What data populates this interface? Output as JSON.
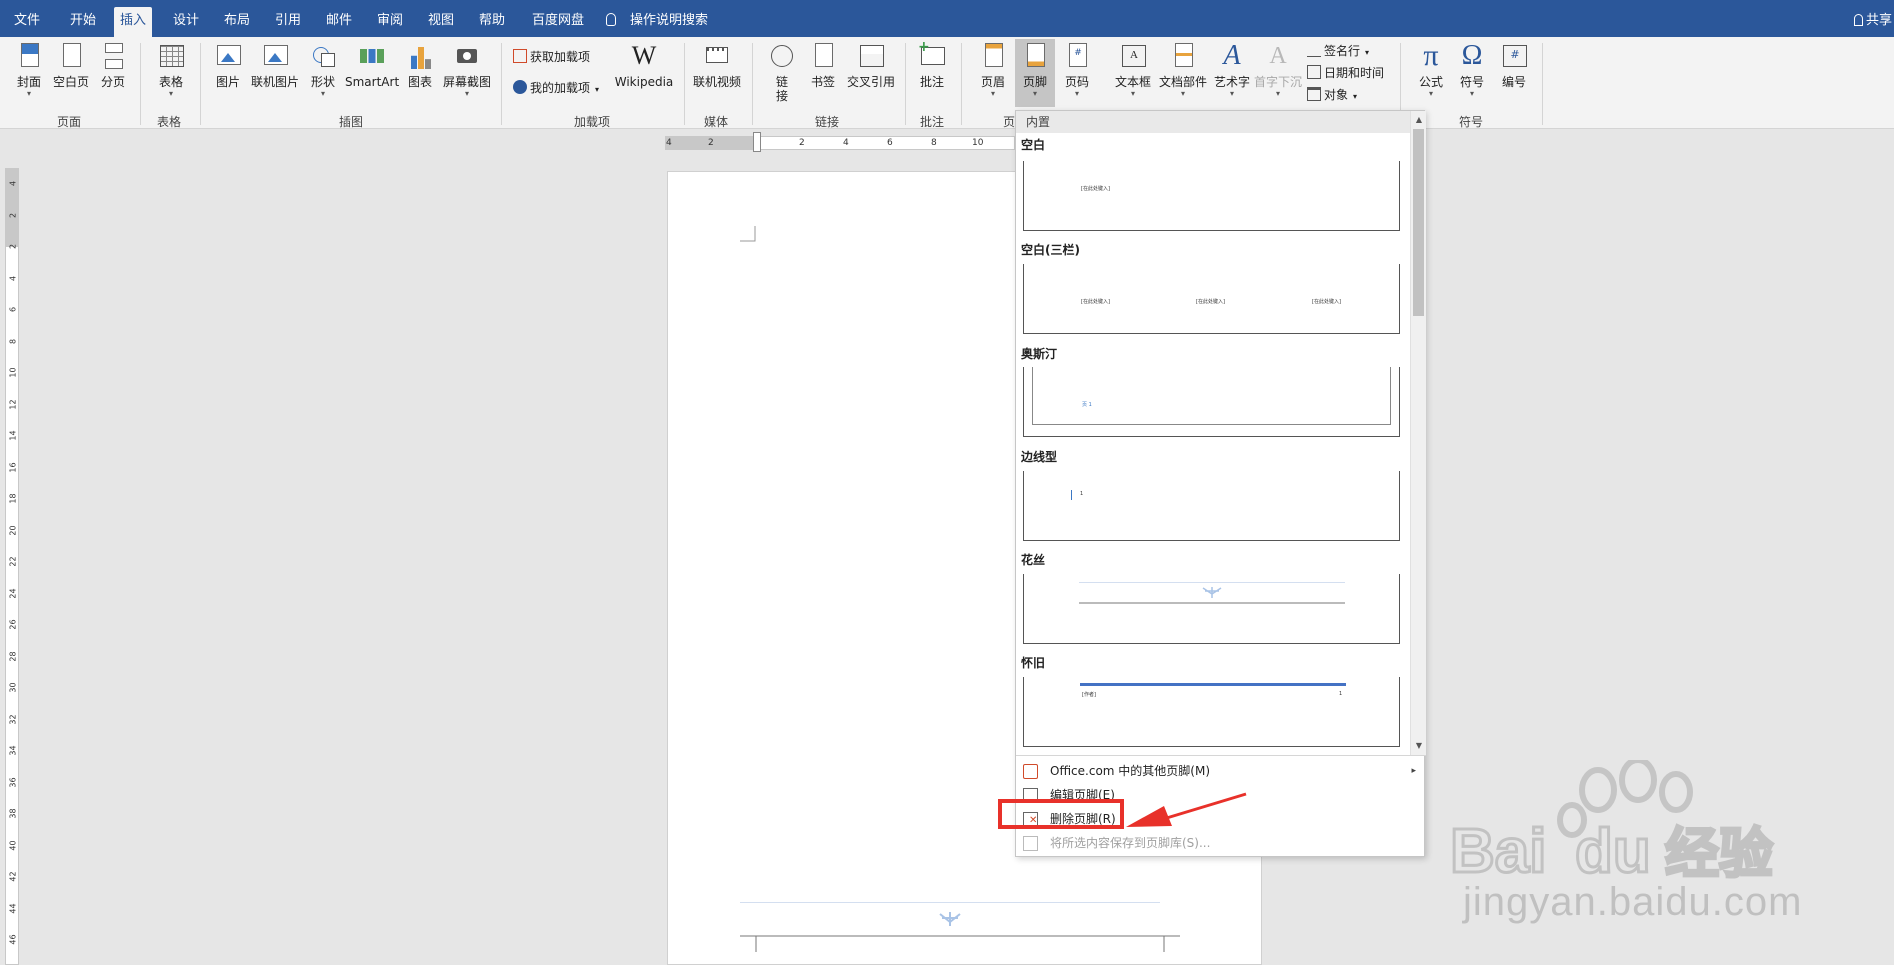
{
  "menubar": {
    "tabs": [
      "文件",
      "开始",
      "插入",
      "设计",
      "布局",
      "引用",
      "邮件",
      "审阅",
      "视图",
      "帮助",
      "百度网盘"
    ],
    "active_tab": "插入",
    "tell_me": "操作说明搜索",
    "share": "共享"
  },
  "ribbon": {
    "pages_group": {
      "label": "页面",
      "cover": "封面",
      "blank_page": "空白页",
      "page_break": "分页"
    },
    "tables_group": {
      "label": "表格",
      "table": "表格"
    },
    "illustrations_group": {
      "label": "插图",
      "pictures": "图片",
      "online_pictures": "联机图片",
      "shapes": "形状",
      "smartart": "SmartArt",
      "chart": "图表",
      "screenshot": "屏幕截图"
    },
    "addins_group": {
      "label": "加载项",
      "get_addins": "获取加载项",
      "my_addins": "我的加载项",
      "wikipedia": "Wikipedia"
    },
    "media_group": {
      "label": "媒体",
      "online_video": "联机视频"
    },
    "links_group": {
      "label": "链接",
      "link": "链接",
      "bookmark": "书签",
      "cross_reference": "交叉引用"
    },
    "comments_group": {
      "label": "批注",
      "comment": "批注"
    },
    "header_footer_group": {
      "label": "页",
      "header": "页眉",
      "footer": "页脚",
      "page_number": "页码"
    },
    "text_group": {
      "textbox": "文本框",
      "quick_parts": "文档部件",
      "wordart": "艺术字",
      "drop_cap": "首字下沉",
      "signature_line": "签名行",
      "date_time": "日期和时间",
      "object": "对象"
    },
    "symbols_group": {
      "label": "符号",
      "equation": "公式",
      "symbol": "符号",
      "number": "编号"
    }
  },
  "ruler": {
    "h_ticks": [
      "4",
      "2",
      "2",
      "4",
      "6",
      "8",
      "10"
    ],
    "v_ticks": [
      "4",
      "2",
      "2",
      "4",
      "6",
      "8",
      "10",
      "12",
      "14",
      "16",
      "18",
      "20",
      "22",
      "24",
      "26",
      "28",
      "30",
      "32",
      "34",
      "36",
      "38",
      "40",
      "42",
      "44",
      "46"
    ],
    "corner": "L"
  },
  "footer_gallery": {
    "section_header": "内置",
    "items": [
      {
        "title": "空白",
        "placeholder": "[在此处键入]"
      },
      {
        "title": "空白(三栏)",
        "placeholder": "[在此处键入]"
      },
      {
        "title": "奥斯汀",
        "sample": "页 1"
      },
      {
        "title": "边线型",
        "sample": "1"
      },
      {
        "title": "花丝"
      },
      {
        "title": "怀旧",
        "left_text": "[作者]",
        "right_text": "1"
      }
    ],
    "menu": [
      {
        "label": "Office.com 中的其他页脚(M)",
        "enabled": true
      },
      {
        "label": "编辑页脚(E)",
        "enabled": true
      },
      {
        "label": "删除页脚(R)",
        "enabled": true
      },
      {
        "label": "将所选内容保存到页脚库(S)...",
        "enabled": false
      }
    ]
  },
  "annotation": {
    "color": "#e8312a"
  },
  "watermark": {
    "text": "jingyan.baidu.com",
    "logo": "Bai du 经验"
  },
  "colors": {
    "accent": "#2b579a",
    "ribbon_bg": "#f3f3f3",
    "highlight": "#e8312a"
  }
}
